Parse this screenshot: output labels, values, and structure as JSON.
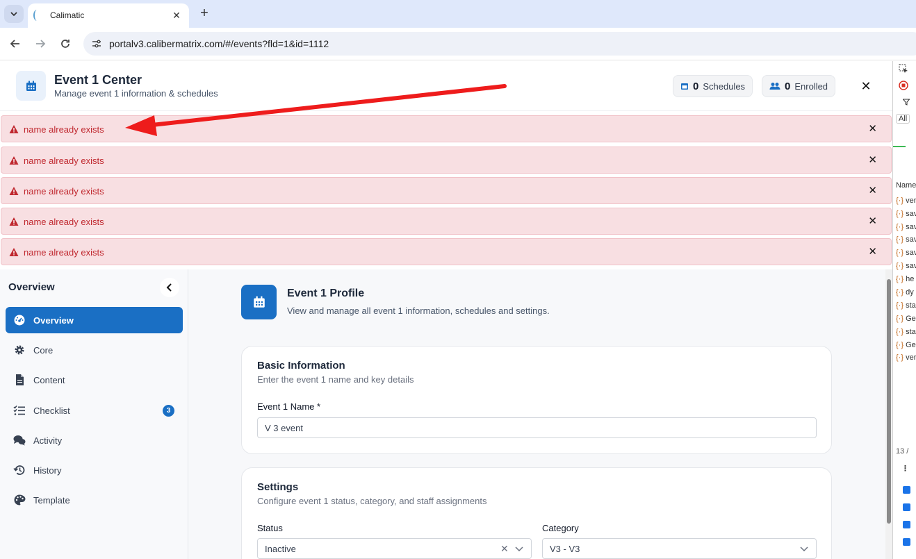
{
  "browser": {
    "tab_title": "Calimatic",
    "url": "portalv3.calibermatrix.com/#/events?fld=1&id=1112"
  },
  "header": {
    "title": "Event 1 Center",
    "subtitle": "Manage event 1 information & schedules",
    "schedules_count": "0",
    "schedules_label": "Schedules",
    "enrolled_count": "0",
    "enrolled_label": "Enrolled"
  },
  "alerts": [
    {
      "text": "name already exists"
    },
    {
      "text": "name already exists"
    },
    {
      "text": "name already exists"
    },
    {
      "text": "name already exists"
    },
    {
      "text": "name already exists"
    }
  ],
  "sidebar": {
    "heading": "Overview",
    "items": [
      {
        "label": "Overview",
        "icon": "dashboard-icon"
      },
      {
        "label": "Core",
        "icon": "gear-icon"
      },
      {
        "label": "Content",
        "icon": "document-icon"
      },
      {
        "label": "Checklist",
        "icon": "checklist-icon",
        "badge": "3"
      },
      {
        "label": "Activity",
        "icon": "chat-icon"
      },
      {
        "label": "History",
        "icon": "history-icon"
      },
      {
        "label": "Template",
        "icon": "palette-icon"
      }
    ]
  },
  "profile": {
    "title": "Event 1 Profile",
    "subtitle": "View and manage all event 1 information, schedules and settings."
  },
  "basic_info": {
    "title": "Basic Information",
    "subtitle": "Enter the event 1 name and key details",
    "name_label": "Event 1 Name *",
    "name_value": "V 3 event"
  },
  "settings": {
    "title": "Settings",
    "subtitle": "Configure event 1 status, category, and staff assignments",
    "status_label": "Status",
    "status_value": "Inactive",
    "category_label": "Category",
    "category_value": "V3 - V3"
  },
  "devtools": {
    "filter_all": "All",
    "name_header": "Name",
    "files": [
      "ver",
      "sav",
      "sav",
      "sav",
      "sav",
      "sav",
      "he",
      "dy",
      "sta",
      "Ge",
      "sta",
      "Ge",
      "ver"
    ],
    "count": "13 /"
  },
  "colors": {
    "accent": "#1a6fc4",
    "alert_bg": "#f8dfe2",
    "alert_text": "#c0282f",
    "annotation_arrow": "#ee1c1c"
  }
}
